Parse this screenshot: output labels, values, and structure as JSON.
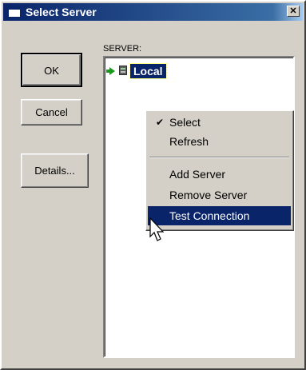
{
  "window": {
    "title": "Select Server",
    "close_glyph": "✕"
  },
  "buttons": {
    "ok": "OK",
    "cancel": "Cancel",
    "details": "Details..."
  },
  "server_list": {
    "label": "SERVER:",
    "items": [
      {
        "label": "Local",
        "icons": [
          "green-arrow-icon",
          "server-icon"
        ],
        "selected": true
      }
    ]
  },
  "context_menu": {
    "items": [
      {
        "label": "Select",
        "checked": true
      },
      {
        "label": "Refresh"
      },
      {
        "separator": true
      },
      {
        "label": "Add Server"
      },
      {
        "label": "Remove Server"
      },
      {
        "label": "Test Connection",
        "highlighted": true
      }
    ]
  },
  "colors": {
    "face": "#d4d0c8",
    "selection": "#0a246a",
    "title_start": "#0a246a",
    "title_end": "#a6caf0"
  }
}
